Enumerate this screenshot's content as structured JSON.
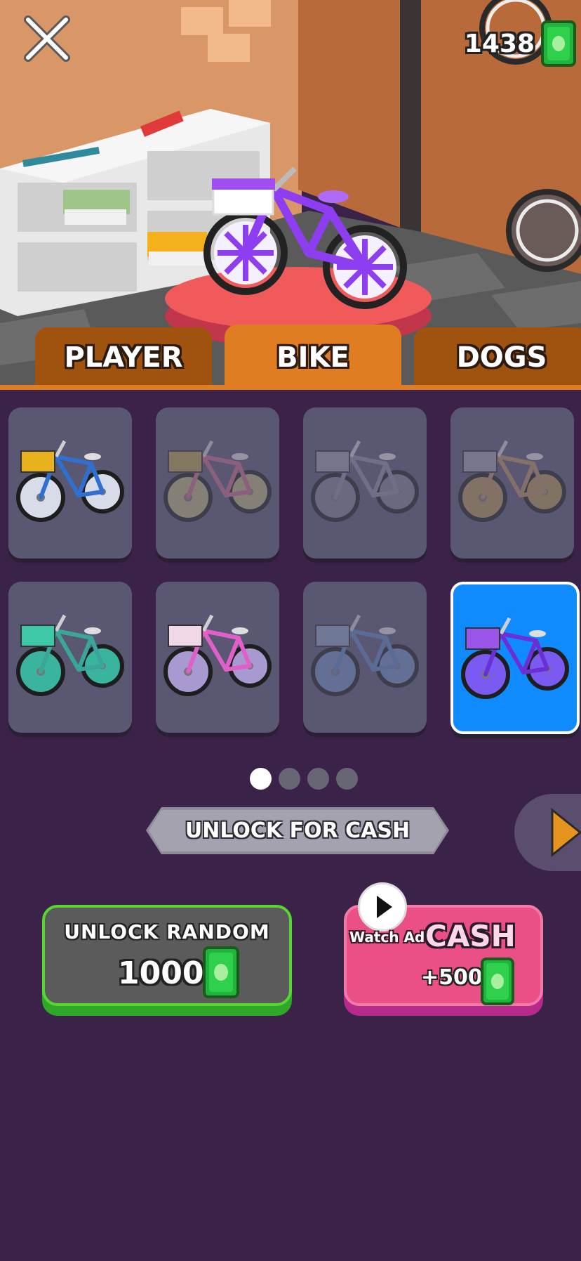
{
  "header": {
    "cash": "1438"
  },
  "tabs": [
    {
      "label": "PLAYER",
      "active": false
    },
    {
      "label": "BIKE",
      "active": true
    },
    {
      "label": "DOGS",
      "active": false
    }
  ],
  "bikes": [
    {
      "frame": "#2f6fd0",
      "basket": "#e7b21c",
      "wheel": "#d8dbe8",
      "locked": false,
      "selected": false
    },
    {
      "frame": "#c46b8a",
      "basket": "#b7a04a",
      "wheel": "#b9b27a",
      "locked": true,
      "selected": false
    },
    {
      "frame": "#8c8ca0",
      "basket": "#9a9aac",
      "wheel": "#7f7f90",
      "locked": true,
      "selected": false
    },
    {
      "frame": "#b89060",
      "basket": "#9aa0b0",
      "wheel": "#b49450",
      "locked": true,
      "selected": false
    },
    {
      "frame": "#3aa69a",
      "basket": "#3ec8a8",
      "wheel": "#3ab49e",
      "locked": false,
      "selected": false
    },
    {
      "frame": "#e05fc8",
      "basket": "#f0d8e6",
      "wheel": "#a89ad0",
      "locked": false,
      "selected": false
    },
    {
      "frame": "#5a86c0",
      "basket": "#8aa2c4",
      "wheel": "#6e8ebe",
      "locked": true,
      "selected": false
    },
    {
      "frame": "#6b2fd6",
      "basket": "#9b55e8",
      "wheel": "#7a5af0",
      "locked": false,
      "selected": true
    }
  ],
  "pagination": {
    "pages": 4,
    "current": 1
  },
  "unlock": {
    "title": "UNLOCK FOR CASH"
  },
  "random": {
    "label": "UNLOCK RANDOM",
    "price": "1000"
  },
  "ad": {
    "watch": "Watch Ad",
    "title": "CASH",
    "reward": "+500"
  },
  "colors": {
    "background": "#3a2249",
    "tab_active": "#e07c22",
    "tab_inactive": "#a0520f",
    "selected_card": "#0f8bff",
    "card": "#5a5773"
  },
  "icons": {
    "close": "close-icon",
    "cash": "cash-bill-icon",
    "next": "play-arrow-icon",
    "play": "play-icon"
  }
}
